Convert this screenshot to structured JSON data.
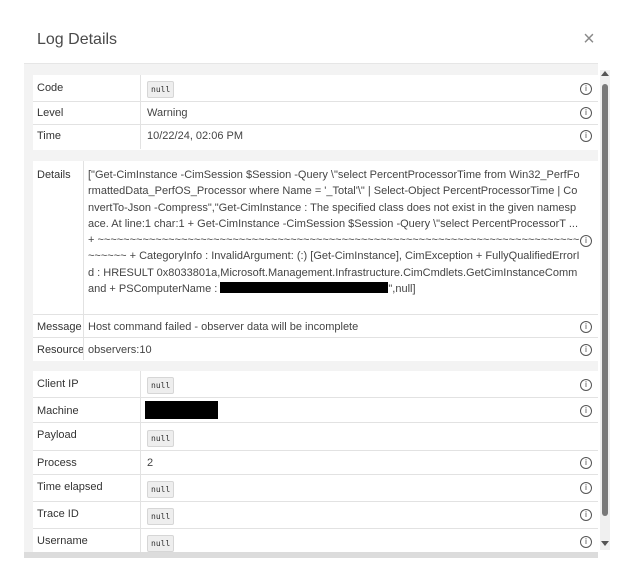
{
  "dialog": {
    "title": "Log Details",
    "close_glyph": "×"
  },
  "top_rows": [
    {
      "label": "Code",
      "value": "null",
      "kind": "chip"
    },
    {
      "label": "Level",
      "value": "Warning",
      "kind": "text"
    },
    {
      "label": "Time",
      "value": "10/22/24, 02:06 PM",
      "kind": "text"
    }
  ],
  "details": {
    "label": "Details",
    "text_before": "[\"Get-CimInstance -CimSession $Session -Query \\\"select PercentProcessorTime from Win32_PerfFormattedData_PerfOS_Processor where Name = '_Total'\\\" | Select-Object PercentProcessorTime | ConvertTo-Json -Compress\",\"Get-CimInstance : The specified class does not exist in the given namespace. At line:1 char:1 + Get-CimInstance -CimSession $Session -Query \\\"select PercentProcessorT ... + ~~~~~~~~~~~~~~~~~~~~~~~~~~~~~~~~~~~~~~~~~~~~~~~~~~~~~~~~~~~~~~~~~~~~~~~~~~~~~~~~~ + CategoryInfo : InvalidArgument: (:) [Get-CimInstance], CimException + FullyQualifiedErrorId : HRESULT 0x8033801a,Microsoft.Management.Infrastructure.CimCmdlets.GetCimInstanceCommand + PSComputerName : ",
    "text_after": "\",null]"
  },
  "message": {
    "label": "Message",
    "value": "Host command failed - observer data will be incomplete"
  },
  "resource": {
    "label": "Resource",
    "value": "observers:10"
  },
  "bottom_rows": [
    {
      "label": "Client IP",
      "value": "null",
      "kind": "chip",
      "info": true
    },
    {
      "label": "Machine",
      "value": "",
      "kind": "redacted",
      "info": true
    },
    {
      "label": "Payload",
      "value": "null",
      "kind": "chip",
      "info": false
    },
    {
      "label": "Process",
      "value": "2",
      "kind": "text",
      "info": true
    },
    {
      "label": "Time elapsed",
      "value": "null",
      "kind": "chip",
      "info": true
    },
    {
      "label": "Trace ID",
      "value": "null",
      "kind": "chip",
      "info": true
    },
    {
      "label": "Username",
      "value": "null",
      "kind": "chip",
      "info": true
    }
  ],
  "icons": {
    "info": "ⓘ-info-icon"
  },
  "info_glyph": "i"
}
